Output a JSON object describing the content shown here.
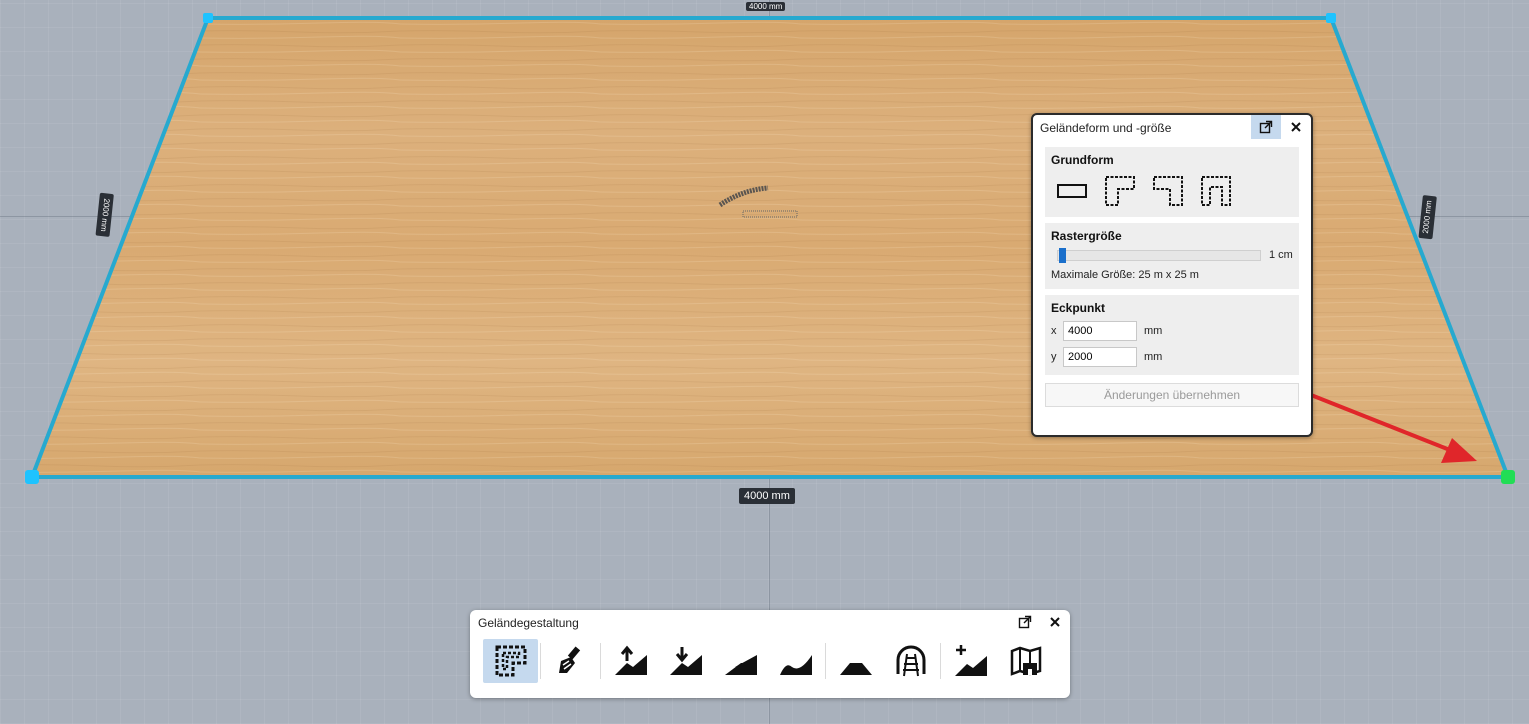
{
  "viewport": {
    "dim_top": "4000 mm",
    "dim_bottom": "4000 mm",
    "dim_left": "2000 mm",
    "dim_right": "2000 mm"
  },
  "terrain_panel": {
    "title": "Geländeform und -größe",
    "grundform": {
      "title": "Grundform",
      "shapes": [
        "rectangle-shape-icon",
        "l-shape-icon",
        "mirrored-l-shape-icon",
        "u-shape-icon"
      ]
    },
    "raster": {
      "title": "Rastergröße",
      "value": "1 cm",
      "slider_fraction": 0.0,
      "max_size": "Maximale Größe: 25 m x 25 m"
    },
    "eckpunkt": {
      "title": "Eckpunkt",
      "x_label": "x",
      "x_value": "4000",
      "y_label": "y",
      "y_value": "2000",
      "unit": "mm"
    },
    "apply_label": "Änderungen übernehmen"
  },
  "toolbar": {
    "title": "Geländegestaltung",
    "tools": [
      "terrain-shape-icon",
      "paint-brush-icon",
      "raise-terrain-icon",
      "lower-terrain-icon",
      "slope-icon",
      "smooth-slope-icon",
      "plateau-icon",
      "tunnel-icon",
      "add-terrain-icon",
      "map-icon"
    ]
  },
  "colors": {
    "board_outline": "#27a9cf",
    "accent": "#1a6fcb",
    "arrow": "#e0262a",
    "corner_active": "#22dd55"
  }
}
